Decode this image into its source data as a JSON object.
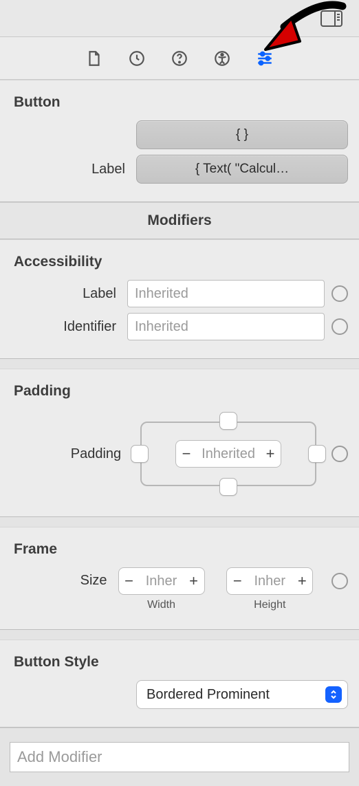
{
  "tabs": {
    "selected": "attributes"
  },
  "button_section": {
    "title": "Button",
    "action_closure": "{ }",
    "label_field": "Label",
    "label_closure": "{ Text( \"Calcul…"
  },
  "modifiers_header": "Modifiers",
  "accessibility": {
    "title": "Accessibility",
    "label_field": "Label",
    "label_placeholder": "Inherited",
    "label_value": "",
    "identifier_field": "Identifier",
    "identifier_placeholder": "Inherited",
    "identifier_value": ""
  },
  "padding": {
    "title": "Padding",
    "field": "Padding",
    "value_placeholder": "Inherited"
  },
  "frame": {
    "title": "Frame",
    "field": "Size",
    "width_placeholder": "Inher",
    "height_placeholder": "Inher",
    "width_sub": "Width",
    "height_sub": "Height"
  },
  "button_style": {
    "title": "Button Style",
    "value": "Bordered Prominent"
  },
  "add_modifier_placeholder": "Add Modifier"
}
